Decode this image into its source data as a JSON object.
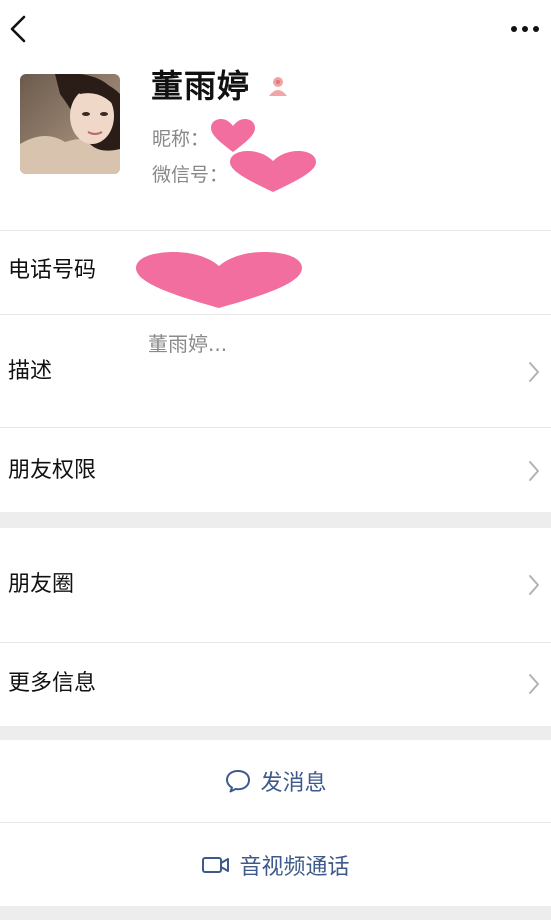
{
  "profile": {
    "display_name": "董雨婷",
    "nickname_label": "昵称：",
    "wechat_id_label": "微信号："
  },
  "rows": {
    "phone": {
      "label": "电话号码"
    },
    "description": {
      "label": "描述",
      "value": "董雨婷..."
    },
    "permissions": {
      "label": "朋友权限"
    },
    "moments": {
      "label": "朋友圈"
    },
    "more_info": {
      "label": "更多信息"
    }
  },
  "actions": {
    "send_message": "发消息",
    "av_call": "音视频通话"
  },
  "colors": {
    "redaction_pink": "#f26e9e",
    "link_blue": "#3f5a8a",
    "background": "#ededed",
    "card": "#ffffff"
  },
  "icons": {
    "back": "chevron-left-icon",
    "more": "more-dots-icon",
    "gender": "female-user-icon",
    "chevron": "chevron-right-icon",
    "message": "chat-bubble-icon",
    "video": "video-camera-icon"
  }
}
